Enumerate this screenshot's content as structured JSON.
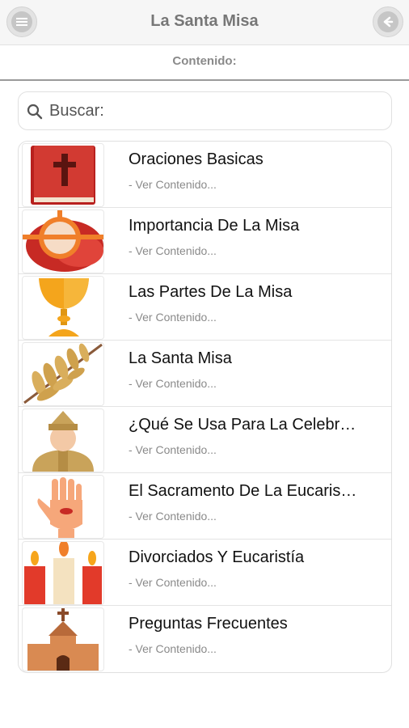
{
  "header": {
    "title": "La Santa Misa",
    "menu_icon": "menu-icon",
    "back_icon": "back-icon"
  },
  "subheader": {
    "label": "Contenido:"
  },
  "search": {
    "placeholder": "Buscar:",
    "icon": "search-icon"
  },
  "items": [
    {
      "title": "Oraciones Basicas",
      "subtitle": "- Ver Contenido...",
      "icon": "bible-icon"
    },
    {
      "title": "Importancia De La Misa",
      "subtitle": "- Ver Contenido...",
      "icon": "host-icon"
    },
    {
      "title": "Las Partes De La Misa",
      "subtitle": "- Ver Contenido...",
      "icon": "chalice-icon"
    },
    {
      "title": "La Santa Misa",
      "subtitle": "- Ver Contenido...",
      "icon": "palm-branch-icon"
    },
    {
      "title": "¿Qué Se Usa Para La Celebr…",
      "subtitle": "- Ver Contenido...",
      "icon": "bishop-icon"
    },
    {
      "title": "El Sacramento De La Eucaris…",
      "subtitle": "- Ver Contenido...",
      "icon": "stigmata-hand-icon"
    },
    {
      "title": "Divorciados Y Eucaristía",
      "subtitle": "- Ver Contenido...",
      "icon": "candles-icon"
    },
    {
      "title": "Preguntas Frecuentes",
      "subtitle": "- Ver Contenido...",
      "icon": "church-icon"
    }
  ]
}
